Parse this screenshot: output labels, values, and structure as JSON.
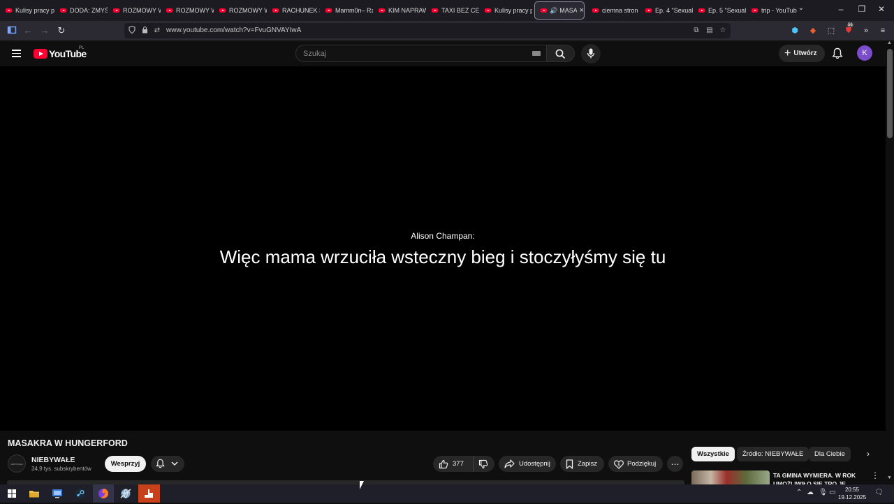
{
  "browser": {
    "tabs": [
      {
        "label": "Kulisy pracy p"
      },
      {
        "label": "DODA: ZMYŚ"
      },
      {
        "label": "ROZMOWY W"
      },
      {
        "label": "ROZMOWY W"
      },
      {
        "label": "ROZMOWY W"
      },
      {
        "label": "RACHUNEK S"
      },
      {
        "label": "Mamm0n– Rz"
      },
      {
        "label": "KIM NAPRAW"
      },
      {
        "label": "TAXI BEZ CEN"
      },
      {
        "label": "Kulisy pracy p"
      },
      {
        "label": "MASA",
        "active": true
      },
      {
        "label": "ciemna stron"
      },
      {
        "label": "Ep. 4 \"Sexual"
      },
      {
        "label": "Ep. 5 \"Sexual"
      },
      {
        "label": "trip - YouTub"
      }
    ],
    "url": "www.youtube.com/watch?v=FvuGNVAYIwA",
    "extension_badge": "56"
  },
  "youtube": {
    "logo_text": "YouTube",
    "country_code": "PL",
    "search_placeholder": "Szukaj",
    "create_label": "Utwórz",
    "avatar_letter": "K"
  },
  "video": {
    "caption_speaker": "Alison Champan:",
    "caption_text": "Więc mama wrzuciła wsteczny bieg i stoczyłyśmy się tu",
    "title": "MASAKRA W HUNGERFORD",
    "channel_name": "NIEBYWAŁE",
    "channel_avatar_text": "NIEBYWAŁE",
    "subscribers": "34,9 tys. subskrybentów",
    "support_label": "Wesprzyj",
    "like_count": "377",
    "share_label": "Udostępnij",
    "save_label": "Zapisz",
    "thanks_label": "Podziękuj"
  },
  "sidebar": {
    "chips": [
      "Wszystkie",
      "Źródło: NIEBYWAŁE",
      "Dla Ciebie"
    ],
    "recommendation_title": "TA GMINA WYMIERA. W ROK UMOŻLIWIŁO SIĘ TRO JE DZIECI"
  },
  "taskbar": {
    "time": "20:55",
    "date": "19.12.2025"
  },
  "colors": {
    "accent_red": "#ff0033",
    "background": "#0f0f0f",
    "avatar": "#7c4dca"
  }
}
